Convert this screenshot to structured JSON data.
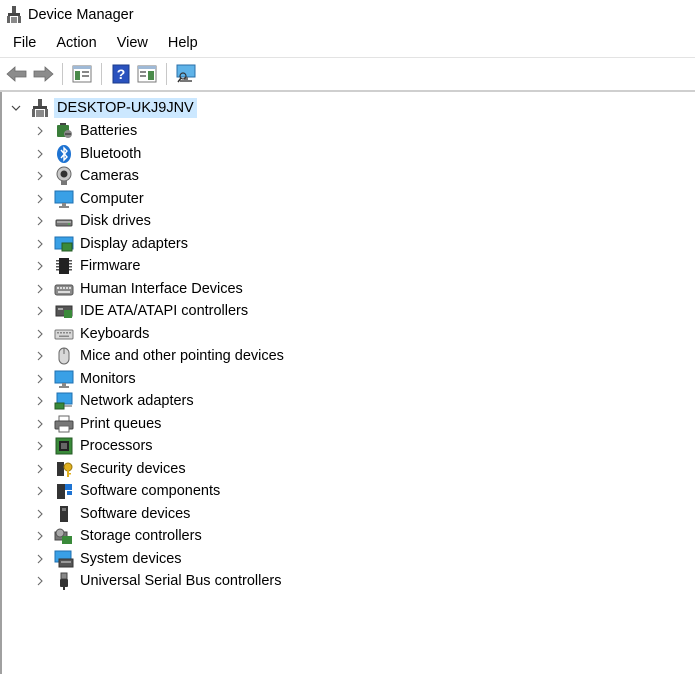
{
  "window": {
    "title": "Device Manager",
    "icon": "device-manager-icon"
  },
  "menu": [
    "File",
    "Action",
    "View",
    "Help"
  ],
  "toolbar": {
    "buttons": [
      "back-arrow-icon",
      "forward-arrow-icon",
      "properties-icon",
      "help-icon",
      "console-tree-icon",
      "monitor-scan-icon"
    ]
  },
  "tree": {
    "root": "DESKTOP-UKJ9JNV",
    "items": [
      {
        "label": "Batteries",
        "icon": "battery-icon"
      },
      {
        "label": "Bluetooth",
        "icon": "bluetooth-icon"
      },
      {
        "label": "Cameras",
        "icon": "camera-icon"
      },
      {
        "label": "Computer",
        "icon": "computer-icon"
      },
      {
        "label": "Disk drives",
        "icon": "disk-drive-icon"
      },
      {
        "label": "Display adapters",
        "icon": "display-adapter-icon"
      },
      {
        "label": "Firmware",
        "icon": "firmware-chip-icon"
      },
      {
        "label": "Human Interface Devices",
        "icon": "hid-icon"
      },
      {
        "label": "IDE ATA/ATAPI controllers",
        "icon": "ide-controller-icon"
      },
      {
        "label": "Keyboards",
        "icon": "keyboard-icon"
      },
      {
        "label": "Mice and other pointing devices",
        "icon": "mouse-icon"
      },
      {
        "label": "Monitors",
        "icon": "monitor-icon"
      },
      {
        "label": "Network adapters",
        "icon": "network-adapter-icon"
      },
      {
        "label": "Print queues",
        "icon": "printer-icon"
      },
      {
        "label": "Processors",
        "icon": "processor-icon"
      },
      {
        "label": "Security devices",
        "icon": "security-key-icon"
      },
      {
        "label": "Software components",
        "icon": "software-component-icon"
      },
      {
        "label": "Software devices",
        "icon": "software-device-icon"
      },
      {
        "label": "Storage controllers",
        "icon": "storage-controller-icon"
      },
      {
        "label": "System devices",
        "icon": "system-device-icon"
      },
      {
        "label": "Universal Serial Bus controllers",
        "icon": "usb-icon"
      }
    ]
  },
  "colors": {
    "selection": "#cce8ff",
    "accent": "#1e73d2"
  }
}
